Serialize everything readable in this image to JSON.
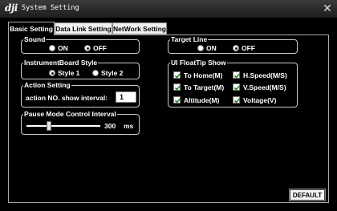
{
  "window": {
    "logo": "dji",
    "title": "System Setting",
    "close_icon": "close-icon"
  },
  "tabs": [
    {
      "label": "Basic Setting",
      "active": true
    },
    {
      "label": "Data Link Setting",
      "active": false
    },
    {
      "label": "NetWork Setting",
      "active": false
    }
  ],
  "sound": {
    "legend": "Sound",
    "options": [
      "ON",
      "OFF"
    ],
    "selected": "OFF"
  },
  "instrument_board": {
    "legend": "InstrumentBoard Style",
    "options": [
      "Style 1",
      "Style 2"
    ],
    "selected": "Style 1"
  },
  "action_setting": {
    "legend": "Action Setting",
    "field_label": "action NO. show interval:",
    "value": "1"
  },
  "pause_mode": {
    "legend": "Pause Mode Control Interval",
    "value": "300",
    "unit": "ms",
    "level": 0.3
  },
  "target_line": {
    "legend": "Target Line",
    "options": [
      "ON",
      "OFF"
    ],
    "selected": "OFF"
  },
  "floattip": {
    "legend": "UI FloatTip Show",
    "items": [
      {
        "label": "To Home(M)",
        "checked": true
      },
      {
        "label": "H.Speed(M/S)",
        "checked": true
      },
      {
        "label": "To Target(M)",
        "checked": true
      },
      {
        "label": "V.Speed(M/S)",
        "checked": true
      },
      {
        "label": "Altitude(M)",
        "checked": true
      },
      {
        "label": "Voltage(V)",
        "checked": true
      }
    ]
  },
  "default_button": {
    "label": "DEFAULT"
  }
}
